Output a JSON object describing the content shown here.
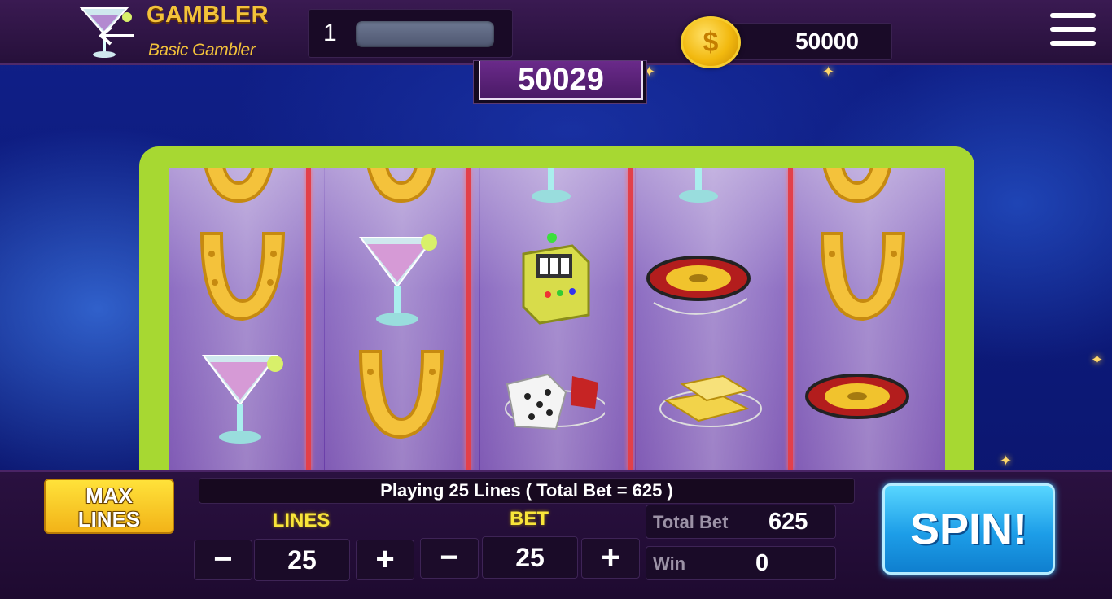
{
  "header": {
    "brand_title": "GAMBLER",
    "brand_subtitle": "Basic Gambler",
    "level": "1",
    "coins": "50000",
    "coin_symbol": "$"
  },
  "jackpot": "50029",
  "reels": [
    [
      "horseshoe",
      "horseshoe",
      "martini-glass"
    ],
    [
      "horseshoe",
      "martini-glass",
      "horseshoe"
    ],
    [
      "martini-glass",
      "slot-machine",
      "dice"
    ],
    [
      "martini-glass",
      "roulette-wheel",
      "gold-bars"
    ],
    [
      "horseshoe",
      "horseshoe",
      "roulette-wheel"
    ]
  ],
  "controls": {
    "max_lines_line1": "MAX",
    "max_lines_line2": "LINES",
    "status": "Playing 25 Lines ( Total Bet = 625 )",
    "lines_label": "LINES",
    "lines_value": "25",
    "bet_label": "BET",
    "bet_value": "25",
    "minus": "−",
    "plus": "+",
    "total_bet_label": "Total Bet",
    "total_bet_value": "625",
    "win_label": "Win",
    "win_value": "0",
    "spin_label": "SPIN!"
  },
  "colors": {
    "frame": "#a7d832",
    "divider": "#e2404a",
    "gold": "#f3c23a",
    "spin": "#1d9ee8"
  }
}
